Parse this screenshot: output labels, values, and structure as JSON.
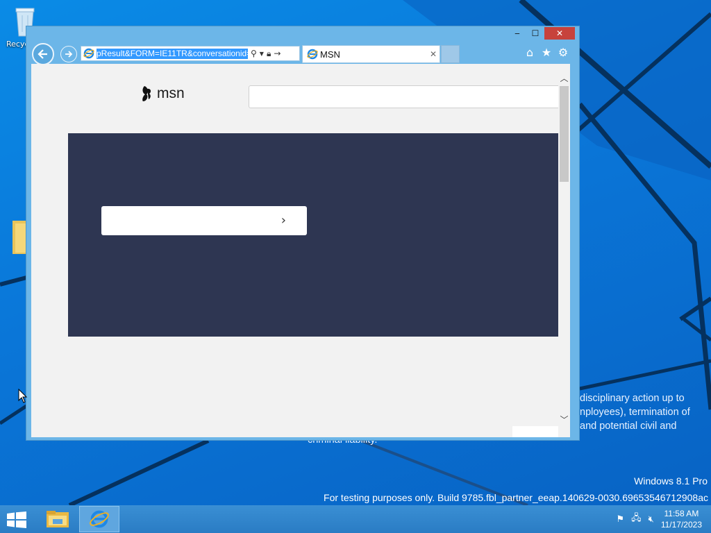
{
  "desktop": {
    "recycle_bin_label": "Recyc",
    "legal_lines": [
      "disciplinary action up to",
      "nployees), termination of",
      "and potential civil and",
      "criminal liability."
    ],
    "edition": "Windows 8.1 Pro",
    "build": "For testing purposes only. Build 9785.fbl_partner_eeap.140629-0030.69653546712908ac"
  },
  "window": {
    "controls": {
      "minimize": "‒",
      "maximize": "☐",
      "close": "✕"
    },
    "address_bar": {
      "url": "pResult&FORM=IE11TR&conversationid="
    },
    "tab": {
      "title": "MSN",
      "close": "✕"
    },
    "toolbar_icons": [
      "home-icon",
      "favorites-star-icon",
      "settings-gear-icon"
    ]
  },
  "page": {
    "logo_text": "msn",
    "search": {
      "placeholder": ""
    },
    "hero_button_chevron": "›"
  },
  "taskbar": {
    "clock_time": "11:58 AM",
    "clock_date": "11/17/2023"
  },
  "colors": {
    "desktop": "#0a76d8",
    "hero": "#2e3652",
    "url_highlight": "#3399ff",
    "close_button": "#c7423c"
  }
}
